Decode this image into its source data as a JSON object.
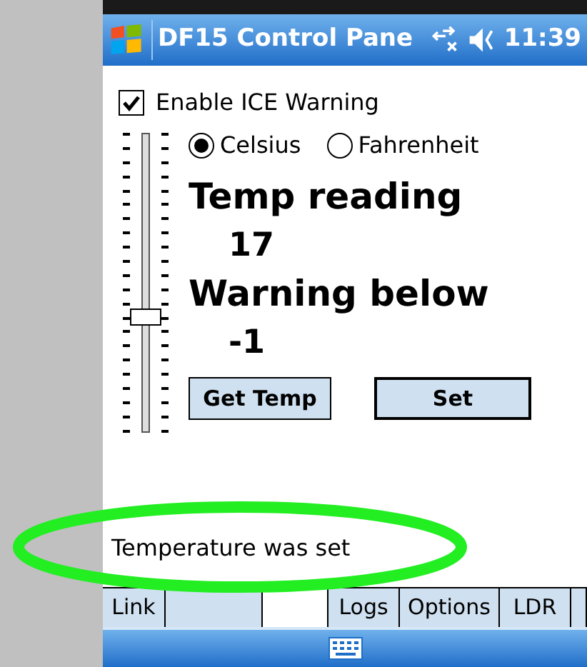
{
  "title_bar": {
    "title": "DF15 Control Pane",
    "time": "11:39"
  },
  "enable_warning": {
    "label": "Enable ICE Warning",
    "checked": true
  },
  "slider": {
    "level": 0.38
  },
  "units": [
    {
      "label": "Celsius",
      "selected": true
    },
    {
      "label": "Fahrenheit",
      "selected": false
    }
  ],
  "temp_reading": {
    "label": "Temp reading",
    "value": "17"
  },
  "warning_below": {
    "label": "Warning below",
    "value": "-1"
  },
  "buttons": [
    {
      "label": "Get Temp"
    },
    {
      "label": "Set"
    }
  ],
  "status_message": "Temperature was set",
  "tabs": [
    {
      "label": "Link",
      "selected": false
    },
    {
      "selected": false
    },
    {
      "selected": true
    },
    {
      "label": "Logs",
      "selected": false
    },
    {
      "label": "Options",
      "selected": false
    },
    {
      "label": "LDR",
      "selected": false
    },
    {
      "selected": false
    }
  ]
}
